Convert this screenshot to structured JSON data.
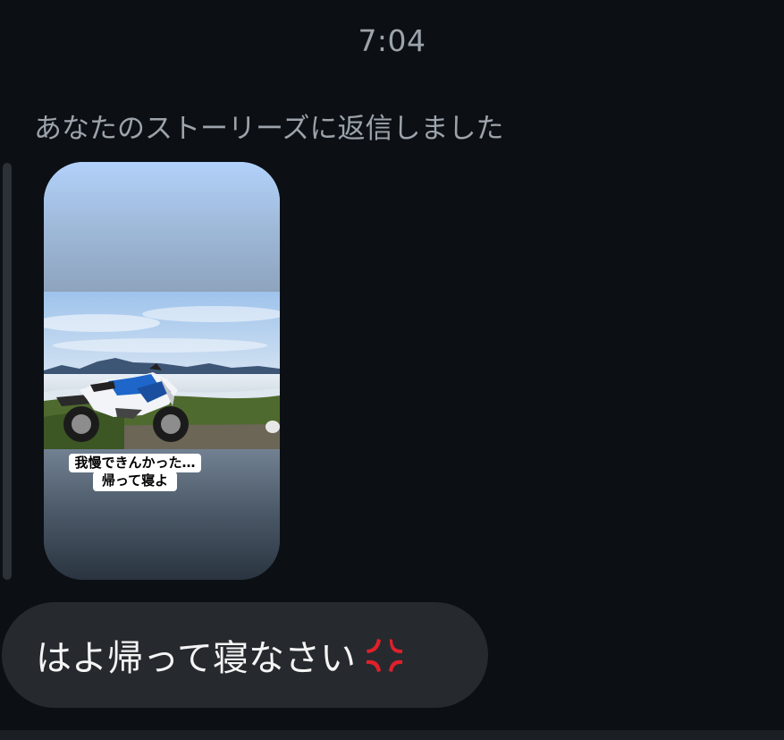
{
  "conversation": {
    "timestamp": "7:04"
  },
  "story_reply": {
    "context_label": "あなたのストーリーズに返信しました",
    "caption_line_1": "我慢できんかった…",
    "caption_line_2": "帰って寝よ"
  },
  "message": {
    "text": "はよ帰って寝なさい",
    "emoji_icon": "anger-symbol-icon",
    "emoji_color": "#e0202a"
  },
  "colors": {
    "background": "#0c1014",
    "bubble": "#262a2f",
    "secondary_text": "#9ca3ab"
  }
}
